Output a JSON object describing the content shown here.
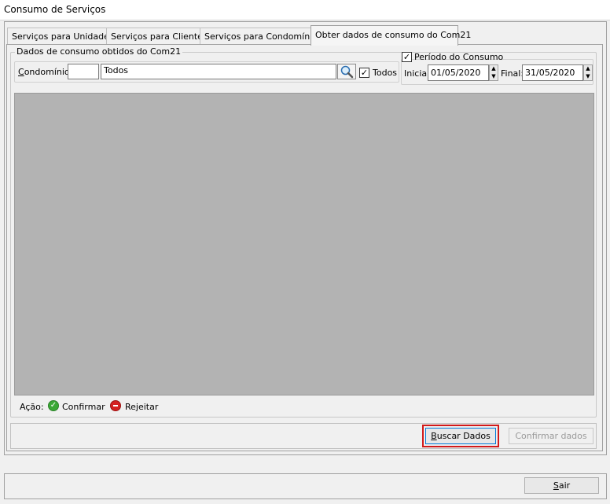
{
  "window": {
    "title": "Consumo de Serviços"
  },
  "tabs": [
    {
      "label": "Serviços para Unidades"
    },
    {
      "label": "Serviços para Clientes"
    },
    {
      "label": "Serviços para Condomínios"
    },
    {
      "label": "Obter dados de consumo do Com21"
    }
  ],
  "active_tab_index": 3,
  "group": {
    "title": "Dados de consumo obtidos do Com21",
    "condominio_label": "Condomínio:",
    "condominio_code": "",
    "condominio_name": "Todos",
    "todos_label": "Todos",
    "todos_checked": true
  },
  "periodo": {
    "label": "Período do Consumo",
    "checked": true,
    "inicial_label": "Inicial:",
    "inicial_value": "01/05/2020",
    "final_label": "Final:",
    "final_value": "31/05/2020"
  },
  "legend": {
    "label": "Ação:",
    "confirm": "Confirmar",
    "reject": "Rejeitar",
    "confirm_color": "#3aa835",
    "reject_color": "#d42020"
  },
  "actions": {
    "buscar": "Buscar Dados",
    "confirmar": "Confirmar dados"
  },
  "footer": {
    "sair": "Sair"
  },
  "colors": {
    "grid_bg": "#b3b3b3",
    "highlight": "#d11a1a"
  }
}
